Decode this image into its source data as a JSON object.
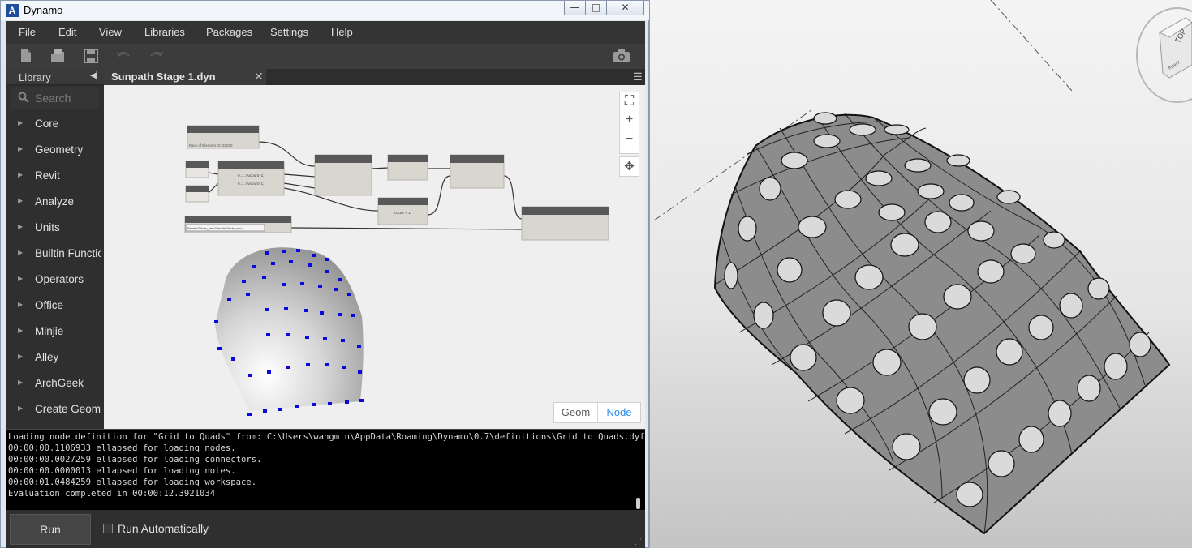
{
  "window": {
    "title": "Dynamo",
    "minimize": "—",
    "maximize": "□",
    "close": "✕"
  },
  "menu": [
    "File",
    "Edit",
    "View",
    "Libraries",
    "Packages",
    "Settings",
    "Help"
  ],
  "toolbar": {
    "icons": [
      "new-file-icon",
      "open-folder-icon",
      "save-icon",
      "undo-icon",
      "redo-icon",
      "camera-icon"
    ]
  },
  "library": {
    "title": "Library",
    "search_placeholder": "Search",
    "items": [
      "Core",
      "Geometry",
      "Revit",
      "Analyze",
      "Units",
      "Builtin Functions",
      "Operators",
      "Office",
      "Minjie",
      "Alley",
      "ArchGeek",
      "Create Geometry"
    ]
  },
  "tab": {
    "label": "Sunpath Stage 1.dyn",
    "close": "✕"
  },
  "canvas": {
    "view_toggle": {
      "geom": "Geom",
      "node": "Node"
    },
    "nodes": {
      "element_label": "Face of Element ID: 32030",
      "code_line1": "0..1..#ucount+1;",
      "code_line2": "0..1..#vcount+1;",
      "count_code": "count + 1;",
      "dropdown_value": "PanelsGHole_new:PanelsGHole_new"
    }
  },
  "console": {
    "lines": [
      "Loading node definition for \"Grid to Quads\" from: C:\\Users\\wangmin\\AppData\\Roaming\\Dynamo\\0.7\\definitions\\Grid to Quads.dyf",
      "00:00:00.1106933 ellapsed for loading nodes.",
      "00:00:00.0027259 ellapsed for loading connectors.",
      "00:00:00.0000013 ellapsed for loading notes.",
      "00:00:01.0484259 ellapsed for loading workspace.",
      "Evaluation completed in 00:00:12.3921034"
    ]
  },
  "runbar": {
    "run_label": "Run",
    "auto_label": "Run Automatically",
    "auto_checked": false
  },
  "viewcube": {
    "face_label": "TOP",
    "side_label": "RIGHT"
  }
}
